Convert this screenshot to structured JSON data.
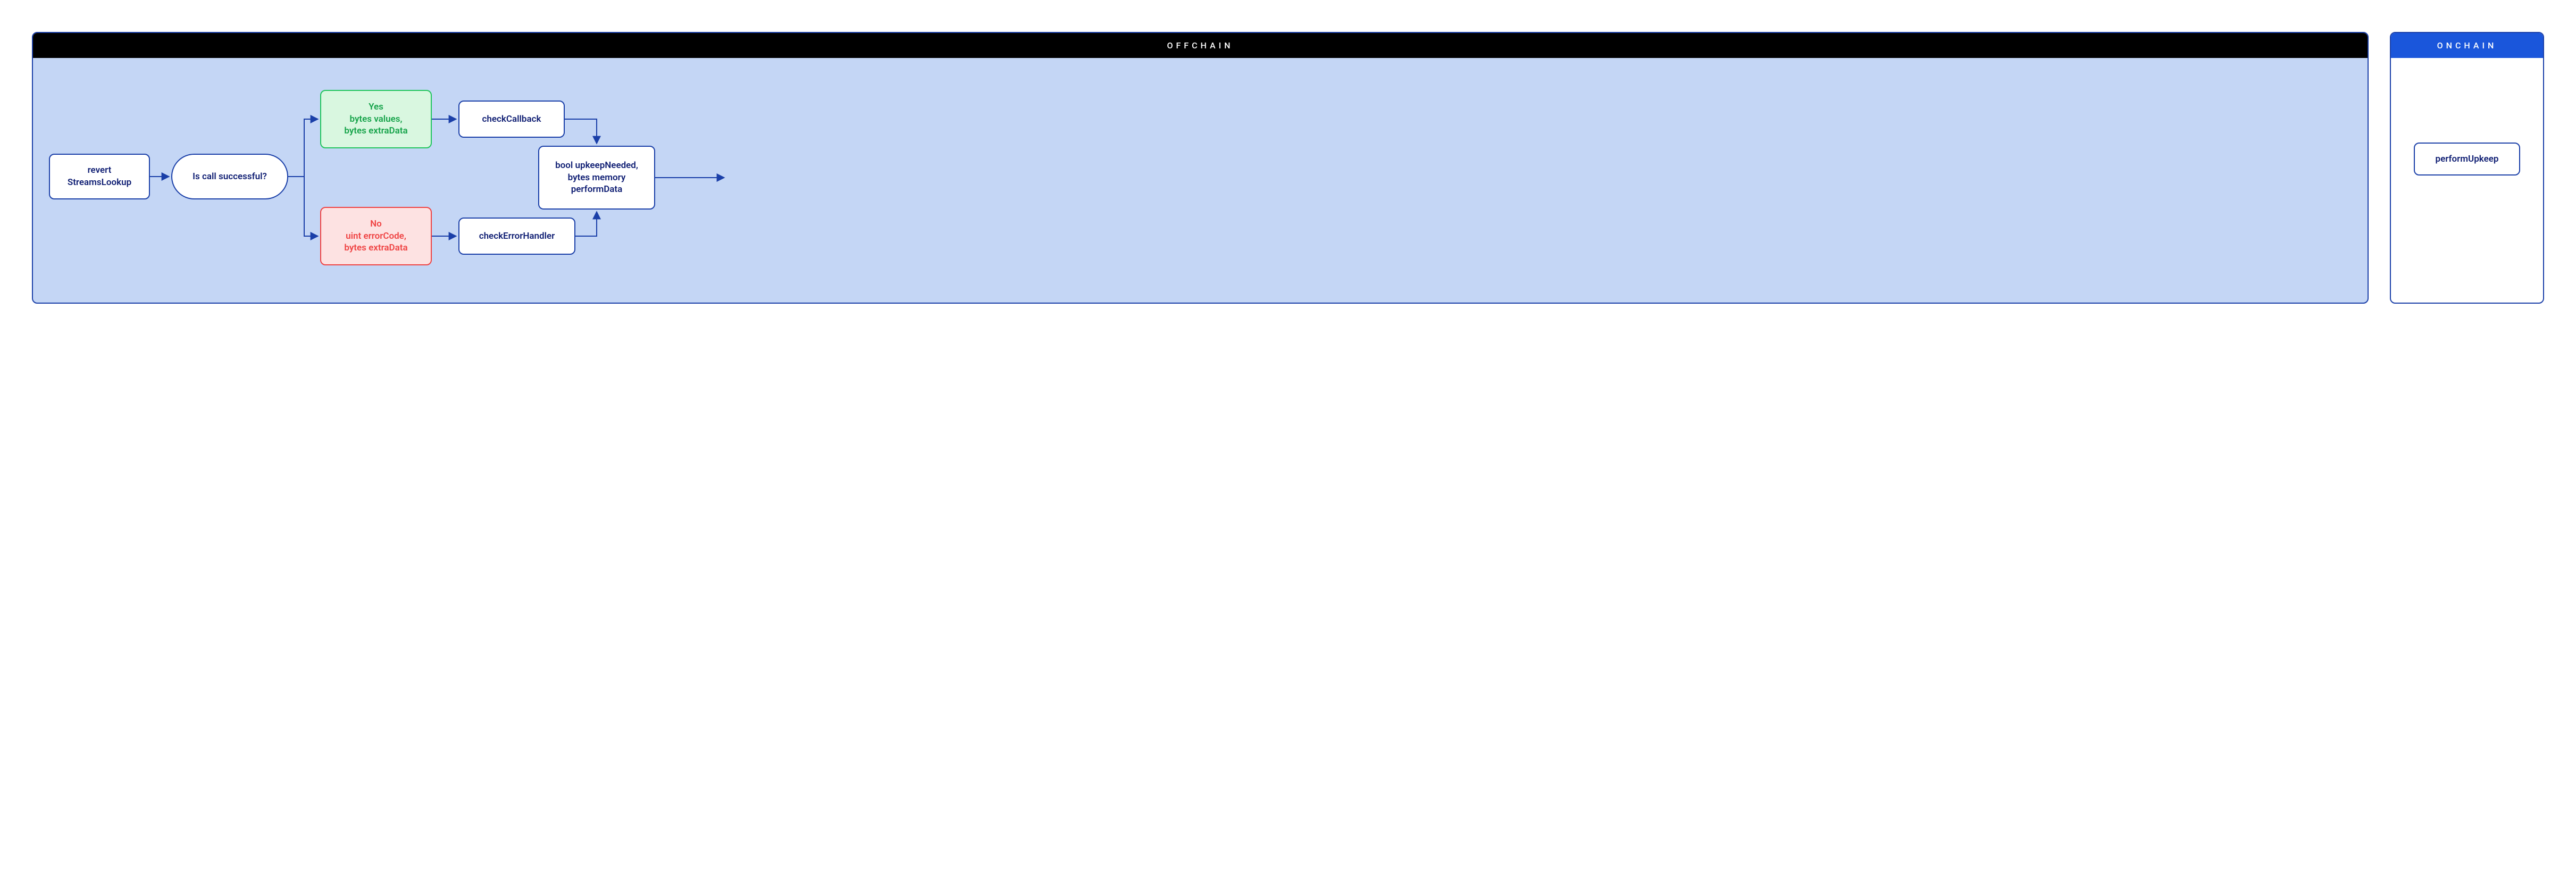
{
  "offchain": {
    "header": "OFFCHAIN",
    "nodes": {
      "revert": "revert StreamsLookup",
      "iscall": "Is call successful?",
      "yes": "Yes\nbytes values,\nbytes extraData",
      "no": "No\nuint errorCode,\nbytes extraData",
      "checkCallback": "checkCallback",
      "checkErrorHandler": "checkErrorHandler",
      "result": "bool upkeepNeeded,\nbytes memory\nperformData"
    }
  },
  "onchain": {
    "header": "ONCHAIN",
    "nodes": {
      "performUpkeep": "performUpkeep"
    }
  },
  "colors": {
    "primary": "#1a3fa8",
    "offchainBg": "#c4d6f5",
    "onchainHeader": "#1a56db",
    "yes": "#22c55e",
    "no": "#ef4444"
  },
  "chart_data": {
    "type": "flowchart",
    "panels": [
      {
        "id": "offchain",
        "label": "OFFCHAIN"
      },
      {
        "id": "onchain",
        "label": "ONCHAIN"
      }
    ],
    "nodes": [
      {
        "id": "revert",
        "label": "revert StreamsLookup",
        "panel": "offchain",
        "shape": "rect"
      },
      {
        "id": "iscall",
        "label": "Is call successful?",
        "panel": "offchain",
        "shape": "stadium"
      },
      {
        "id": "yes",
        "label": "Yes — bytes values, bytes extraData",
        "panel": "offchain",
        "shape": "rect",
        "status": "success"
      },
      {
        "id": "no",
        "label": "No — uint errorCode, bytes extraData",
        "panel": "offchain",
        "shape": "rect",
        "status": "error"
      },
      {
        "id": "checkCallback",
        "label": "checkCallback",
        "panel": "offchain",
        "shape": "rect"
      },
      {
        "id": "checkErrorHandler",
        "label": "checkErrorHandler",
        "panel": "offchain",
        "shape": "rect"
      },
      {
        "id": "result",
        "label": "bool upkeepNeeded, bytes memory performData",
        "panel": "offchain",
        "shape": "rect"
      },
      {
        "id": "performUpkeep",
        "label": "performUpkeep",
        "panel": "onchain",
        "shape": "rect"
      }
    ],
    "edges": [
      {
        "from": "revert",
        "to": "iscall"
      },
      {
        "from": "iscall",
        "to": "yes"
      },
      {
        "from": "iscall",
        "to": "no"
      },
      {
        "from": "yes",
        "to": "checkCallback"
      },
      {
        "from": "no",
        "to": "checkErrorHandler"
      },
      {
        "from": "checkCallback",
        "to": "result"
      },
      {
        "from": "checkErrorHandler",
        "to": "result"
      },
      {
        "from": "result",
        "to": "performUpkeep"
      }
    ]
  }
}
